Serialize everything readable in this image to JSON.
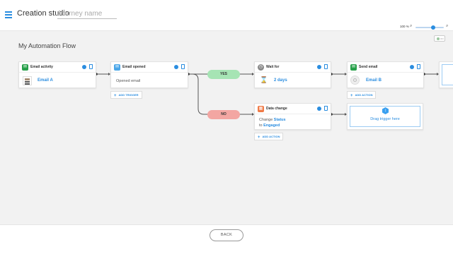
{
  "header": {
    "app_title": "Creation studio",
    "journey_name_placeholder": "Journey name"
  },
  "zoom": {
    "level_text": "100 %",
    "level": 100,
    "out_glyph": "⌕",
    "in_glyph": "⌕"
  },
  "canvas": {
    "flow_title": "My Automation Flow",
    "toggle_label": "ON"
  },
  "nodes": {
    "email_activity": {
      "title": "Email activity",
      "link": "Email A",
      "icon": "email-activity-icon",
      "icon_color": "#27a04a"
    },
    "email_opened": {
      "title": "Email opened",
      "text": "Opened email",
      "icon": "email-opened-icon",
      "icon_color": "#4aa6e8",
      "add_label": "ADD TRIGGER"
    },
    "wait_for": {
      "title": "Wait for",
      "link": "2 days",
      "icon": "clock-icon",
      "icon_color": "#888888"
    },
    "send_email": {
      "title": "Send email",
      "link": "Email B",
      "icon": "send-email-icon",
      "icon_color": "#27a04a",
      "add_label": "ADD ACTION"
    },
    "data_change": {
      "title": "Data change",
      "line1_prefix": "Change ",
      "line1_value": "Status",
      "line2_prefix": "to ",
      "line2_value": "Engaged",
      "icon": "data-change-icon",
      "icon_color": "#f07a46",
      "add_label": "ADD ACTION"
    },
    "drag_trigger": {
      "text": "Drag trigger here",
      "icon": "drag-trigger-icon"
    }
  },
  "branches": {
    "yes_label": "YES",
    "no_label": "NO",
    "yes_color": "#a6e4b4",
    "no_color": "#f3a6a2"
  },
  "footer": {
    "back_label": "BACK"
  },
  "colors": {
    "accent": "#2a8de0",
    "canvas_bg": "#f2f2f2"
  }
}
